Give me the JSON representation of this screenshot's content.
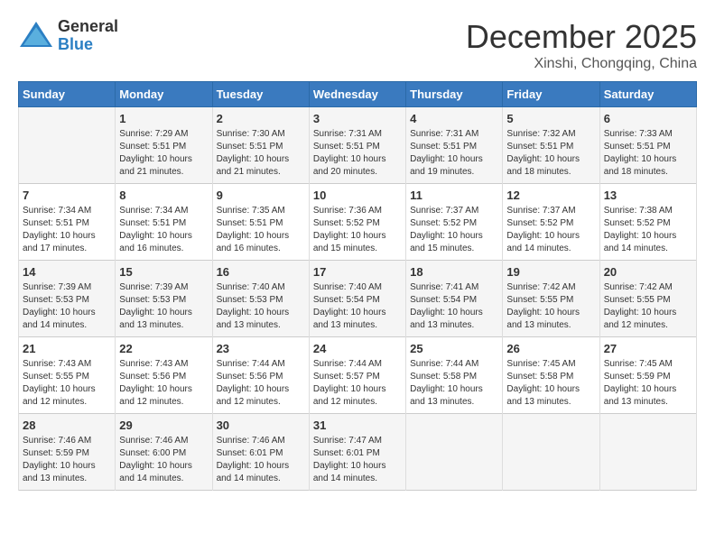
{
  "logo": {
    "general": "General",
    "blue": "Blue"
  },
  "title": "December 2025",
  "subtitle": "Xinshi, Chongqing, China",
  "headers": [
    "Sunday",
    "Monday",
    "Tuesday",
    "Wednesday",
    "Thursday",
    "Friday",
    "Saturday"
  ],
  "weeks": [
    [
      {
        "day": "",
        "info": ""
      },
      {
        "day": "1",
        "info": "Sunrise: 7:29 AM\nSunset: 5:51 PM\nDaylight: 10 hours\nand 21 minutes."
      },
      {
        "day": "2",
        "info": "Sunrise: 7:30 AM\nSunset: 5:51 PM\nDaylight: 10 hours\nand 21 minutes."
      },
      {
        "day": "3",
        "info": "Sunrise: 7:31 AM\nSunset: 5:51 PM\nDaylight: 10 hours\nand 20 minutes."
      },
      {
        "day": "4",
        "info": "Sunrise: 7:31 AM\nSunset: 5:51 PM\nDaylight: 10 hours\nand 19 minutes."
      },
      {
        "day": "5",
        "info": "Sunrise: 7:32 AM\nSunset: 5:51 PM\nDaylight: 10 hours\nand 18 minutes."
      },
      {
        "day": "6",
        "info": "Sunrise: 7:33 AM\nSunset: 5:51 PM\nDaylight: 10 hours\nand 18 minutes."
      }
    ],
    [
      {
        "day": "7",
        "info": "Sunrise: 7:34 AM\nSunset: 5:51 PM\nDaylight: 10 hours\nand 17 minutes."
      },
      {
        "day": "8",
        "info": "Sunrise: 7:34 AM\nSunset: 5:51 PM\nDaylight: 10 hours\nand 16 minutes."
      },
      {
        "day": "9",
        "info": "Sunrise: 7:35 AM\nSunset: 5:51 PM\nDaylight: 10 hours\nand 16 minutes."
      },
      {
        "day": "10",
        "info": "Sunrise: 7:36 AM\nSunset: 5:52 PM\nDaylight: 10 hours\nand 15 minutes."
      },
      {
        "day": "11",
        "info": "Sunrise: 7:37 AM\nSunset: 5:52 PM\nDaylight: 10 hours\nand 15 minutes."
      },
      {
        "day": "12",
        "info": "Sunrise: 7:37 AM\nSunset: 5:52 PM\nDaylight: 10 hours\nand 14 minutes."
      },
      {
        "day": "13",
        "info": "Sunrise: 7:38 AM\nSunset: 5:52 PM\nDaylight: 10 hours\nand 14 minutes."
      }
    ],
    [
      {
        "day": "14",
        "info": "Sunrise: 7:39 AM\nSunset: 5:53 PM\nDaylight: 10 hours\nand 14 minutes."
      },
      {
        "day": "15",
        "info": "Sunrise: 7:39 AM\nSunset: 5:53 PM\nDaylight: 10 hours\nand 13 minutes."
      },
      {
        "day": "16",
        "info": "Sunrise: 7:40 AM\nSunset: 5:53 PM\nDaylight: 10 hours\nand 13 minutes."
      },
      {
        "day": "17",
        "info": "Sunrise: 7:40 AM\nSunset: 5:54 PM\nDaylight: 10 hours\nand 13 minutes."
      },
      {
        "day": "18",
        "info": "Sunrise: 7:41 AM\nSunset: 5:54 PM\nDaylight: 10 hours\nand 13 minutes."
      },
      {
        "day": "19",
        "info": "Sunrise: 7:42 AM\nSunset: 5:55 PM\nDaylight: 10 hours\nand 13 minutes."
      },
      {
        "day": "20",
        "info": "Sunrise: 7:42 AM\nSunset: 5:55 PM\nDaylight: 10 hours\nand 12 minutes."
      }
    ],
    [
      {
        "day": "21",
        "info": "Sunrise: 7:43 AM\nSunset: 5:55 PM\nDaylight: 10 hours\nand 12 minutes."
      },
      {
        "day": "22",
        "info": "Sunrise: 7:43 AM\nSunset: 5:56 PM\nDaylight: 10 hours\nand 12 minutes."
      },
      {
        "day": "23",
        "info": "Sunrise: 7:44 AM\nSunset: 5:56 PM\nDaylight: 10 hours\nand 12 minutes."
      },
      {
        "day": "24",
        "info": "Sunrise: 7:44 AM\nSunset: 5:57 PM\nDaylight: 10 hours\nand 12 minutes."
      },
      {
        "day": "25",
        "info": "Sunrise: 7:44 AM\nSunset: 5:58 PM\nDaylight: 10 hours\nand 13 minutes."
      },
      {
        "day": "26",
        "info": "Sunrise: 7:45 AM\nSunset: 5:58 PM\nDaylight: 10 hours\nand 13 minutes."
      },
      {
        "day": "27",
        "info": "Sunrise: 7:45 AM\nSunset: 5:59 PM\nDaylight: 10 hours\nand 13 minutes."
      }
    ],
    [
      {
        "day": "28",
        "info": "Sunrise: 7:46 AM\nSunset: 5:59 PM\nDaylight: 10 hours\nand 13 minutes."
      },
      {
        "day": "29",
        "info": "Sunrise: 7:46 AM\nSunset: 6:00 PM\nDaylight: 10 hours\nand 14 minutes."
      },
      {
        "day": "30",
        "info": "Sunrise: 7:46 AM\nSunset: 6:01 PM\nDaylight: 10 hours\nand 14 minutes."
      },
      {
        "day": "31",
        "info": "Sunrise: 7:47 AM\nSunset: 6:01 PM\nDaylight: 10 hours\nand 14 minutes."
      },
      {
        "day": "",
        "info": ""
      },
      {
        "day": "",
        "info": ""
      },
      {
        "day": "",
        "info": ""
      }
    ]
  ]
}
